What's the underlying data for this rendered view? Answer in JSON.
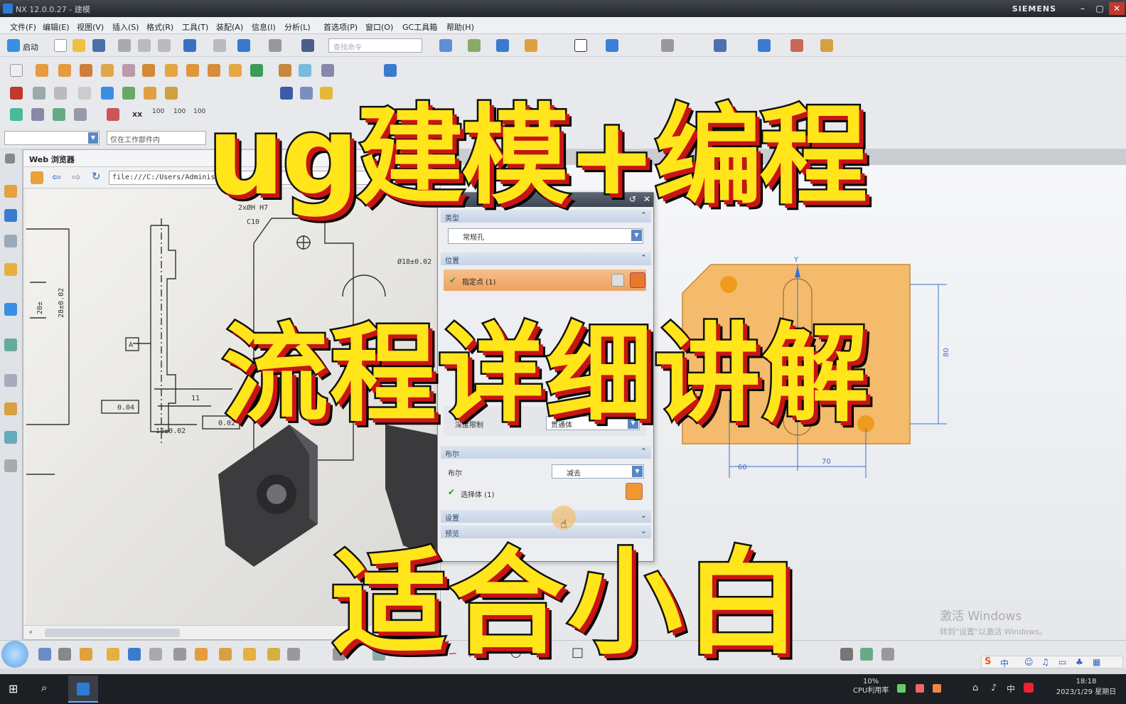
{
  "window": {
    "title": "NX 12.0.0.27 - 建模",
    "brand": "SIEMENS"
  },
  "menu": [
    "文件(F)",
    "编辑(E)",
    "视图(V)",
    "插入(S)",
    "格式(R)",
    "工具(T)",
    "装配(A)",
    "信息(I)",
    "分析(L)",
    "首选项(P)",
    "窗口(O)",
    "GC工具箱",
    "帮助(H)"
  ],
  "toolbar": {
    "start_label": "启动",
    "search_placeholder": "查找命令",
    "filter_value": "仅在工作部件内"
  },
  "web_panel": {
    "title": "Web 浏览器",
    "address": "file:///C:/Users/Administrat"
  },
  "drawing": {
    "labels": [
      "2xØH H7",
      "C10",
      "Ø18±0.02",
      "A",
      "0.04",
      "0.02",
      "11",
      "18±0.02",
      "28±0.02",
      "20±"
    ]
  },
  "dialog": {
    "sections": {
      "type": "类型",
      "position": "位置",
      "boolean": "布尔",
      "settings": "设置",
      "preview": "预览"
    },
    "type_value": "常规孔",
    "position_value": "指定点 (1)",
    "limit_label": "深度限制",
    "limit_value": "贯通体",
    "boolean_label": "布尔",
    "boolean_value": "减去",
    "select_body": "选择体 (1)"
  },
  "sketch": {
    "dim_60": "60",
    "dim_70": "70",
    "dim_right": "80",
    "axis_y": "Y"
  },
  "watermark": {
    "line1": "激活 Windows",
    "line2": "转到\"设置\"以激活 Windows。"
  },
  "taskbar": {
    "cpu_percent": "10%",
    "cpu_label": "CPU利用率",
    "time": "18:18",
    "date": "2023/1/29 星期日"
  },
  "overlay": {
    "line1": "ug建模+编程",
    "line2": "流程详细讲解",
    "line3": "适合小白"
  },
  "colors": {
    "overlay_text": "#ffe51a",
    "overlay_shadow": "#c81414",
    "part_fill": "#f4bb6c",
    "dialog_highlight": "#e89a5a"
  }
}
